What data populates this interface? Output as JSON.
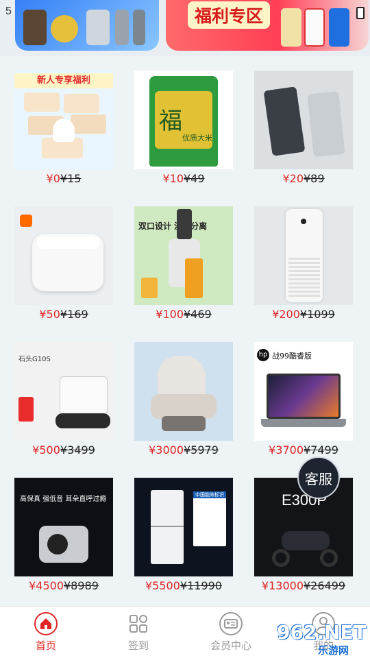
{
  "status": {
    "time": "5"
  },
  "banner": {
    "promo_title": "福利专区"
  },
  "products": [
    {
      "price": "¥0",
      "original": "¥15",
      "label": "新人专享福利",
      "kind": "tissue"
    },
    {
      "price": "¥10",
      "original": "¥49",
      "label": "优质大米",
      "kind": "rice"
    },
    {
      "price": "¥20",
      "original": "¥89",
      "label": "",
      "kind": "powerbank"
    },
    {
      "price": "¥50",
      "original": "¥169",
      "label": "",
      "kind": "ricecooker"
    },
    {
      "price": "¥100",
      "original": "¥469",
      "label": "双口设计   渣汁分离",
      "kind": "juicer"
    },
    {
      "price": "¥200",
      "original": "¥1099",
      "label": "",
      "kind": "purifier"
    },
    {
      "price": "¥500",
      "original": "¥3499",
      "label": "石头G10S",
      "kind": "robot"
    },
    {
      "price": "¥3000",
      "original": "¥5979",
      "label": "",
      "kind": "massage"
    },
    {
      "price": "¥3700",
      "original": "¥7499",
      "label": "战99酷睿版",
      "kind": "laptop"
    },
    {
      "price": "¥4500",
      "original": "¥8989",
      "label": "高保真 强低音 耳朵直呼过瘾",
      "kind": "projector"
    },
    {
      "price": "¥5500",
      "original": "¥11990",
      "label": "中国能效标识",
      "kind": "fridge"
    },
    {
      "price": "¥13000",
      "original": "¥26499",
      "label": "E300P",
      "kind": "scooter"
    }
  ],
  "service": {
    "label": "客服"
  },
  "nav": [
    {
      "label": "首页",
      "icon": "home-icon",
      "active": true
    },
    {
      "label": "签到",
      "icon": "grid-icon",
      "active": false
    },
    {
      "label": "会员中心",
      "icon": "member-card-icon",
      "active": false
    },
    {
      "label": "我的",
      "icon": "profile-icon",
      "active": false
    }
  ],
  "watermark": {
    "big": "962.NET",
    "small": "乐游网"
  },
  "colors": {
    "price": "#e02424",
    "nav_active": "#e02424",
    "nav_inactive": "#9a9a9a"
  }
}
